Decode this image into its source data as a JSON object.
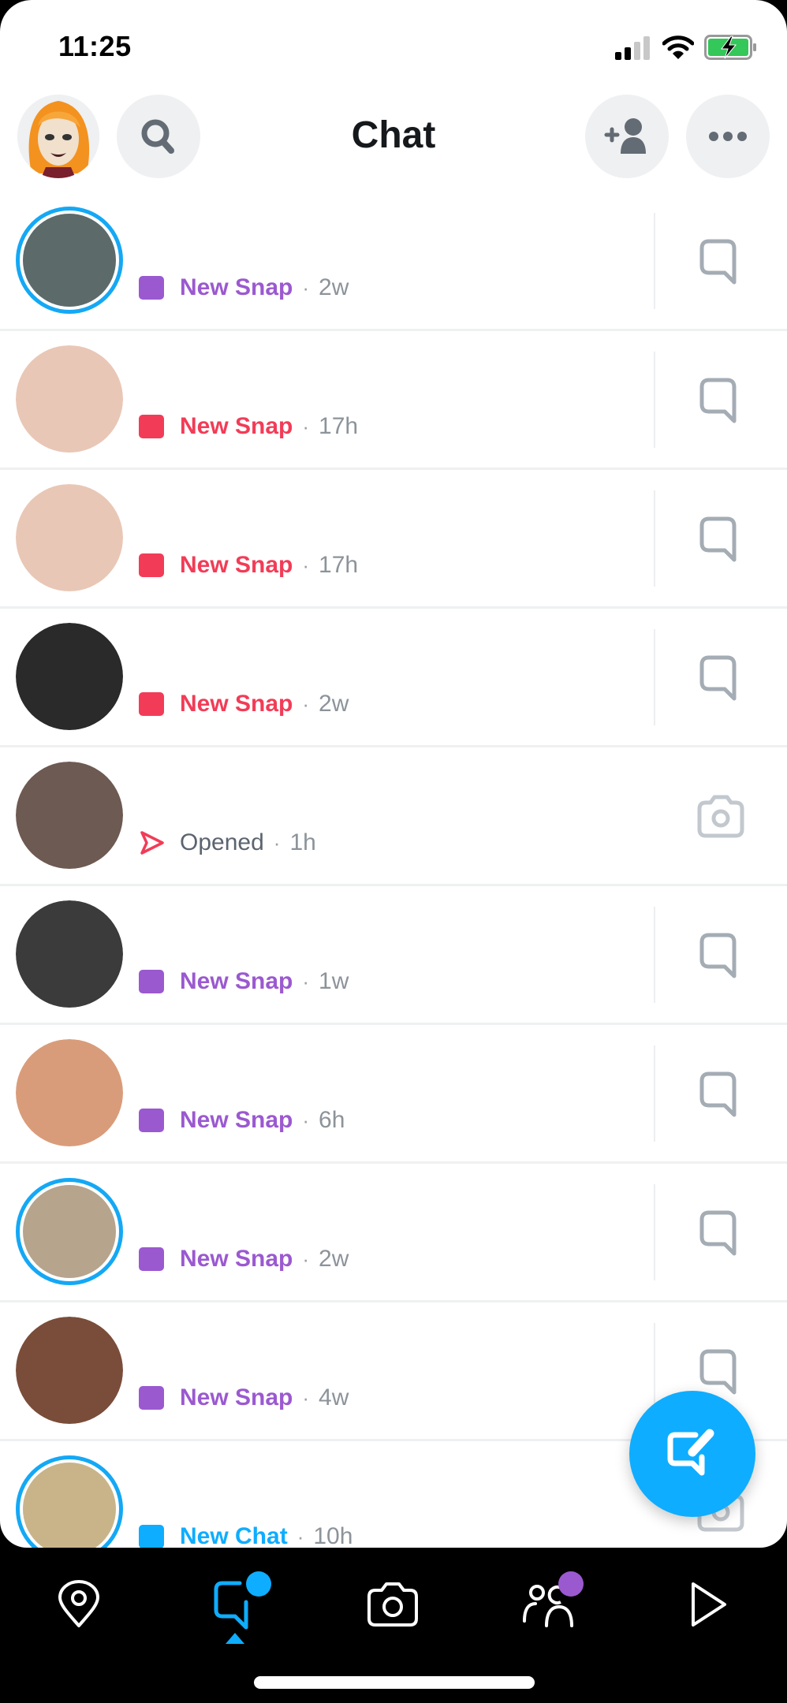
{
  "status_bar": {
    "time": "11:25",
    "signal_bars": 2,
    "signal_bars_total": 4,
    "wifi": "wifi-icon",
    "battery": "battery-charging-icon",
    "battery_color": "#34c759"
  },
  "header": {
    "title": "Chat",
    "profile_avatar": "bitmoji-avatar",
    "search_icon": "search-icon",
    "add_friend_icon": "add-friend-icon",
    "more_icon": "more-horizontal-icon"
  },
  "colors": {
    "purple": "#9b59d0",
    "red": "#f23c57",
    "blue": "#0eadff",
    "meta_gray": "#8c939a"
  },
  "chats": [
    {
      "status": "New Snap",
      "type": "purple",
      "ago": "2w",
      "action": "chat",
      "story_ring": true
    },
    {
      "status": "New Snap",
      "type": "red",
      "ago": "17h",
      "action": "chat",
      "story_ring": false
    },
    {
      "status": "New Snap",
      "type": "red",
      "ago": "17h",
      "action": "chat",
      "story_ring": false
    },
    {
      "status": "New Snap",
      "type": "red",
      "ago": "2w",
      "action": "chat",
      "story_ring": false
    },
    {
      "status": "Opened",
      "type": "opened",
      "ago": "1h",
      "action": "camera",
      "story_ring": false
    },
    {
      "status": "New Snap",
      "type": "purple",
      "ago": "1w",
      "action": "chat",
      "story_ring": false
    },
    {
      "status": "New Snap",
      "type": "purple",
      "ago": "6h",
      "action": "chat",
      "story_ring": false
    },
    {
      "status": "New Snap",
      "type": "purple",
      "ago": "2w",
      "action": "chat",
      "story_ring": true
    },
    {
      "status": "New Snap",
      "type": "purple",
      "ago": "4w",
      "action": "chat",
      "story_ring": false
    },
    {
      "status": "New Chat",
      "type": "blue",
      "ago": "10h",
      "action": "camera",
      "story_ring": true
    }
  ],
  "separator": "·",
  "fab": {
    "icon": "new-chat-icon"
  },
  "bottom_nav": {
    "items": [
      {
        "name": "map",
        "icon": "map-pin-icon",
        "active": false,
        "badge": null
      },
      {
        "name": "chat",
        "icon": "chat-icon",
        "active": true,
        "badge": "#0eadff"
      },
      {
        "name": "camera",
        "icon": "camera-icon",
        "active": false,
        "badge": null
      },
      {
        "name": "stories",
        "icon": "friends-icon",
        "active": false,
        "badge": "#9b59d0"
      },
      {
        "name": "spotlight",
        "icon": "play-icon",
        "active": false,
        "badge": null
      }
    ]
  }
}
